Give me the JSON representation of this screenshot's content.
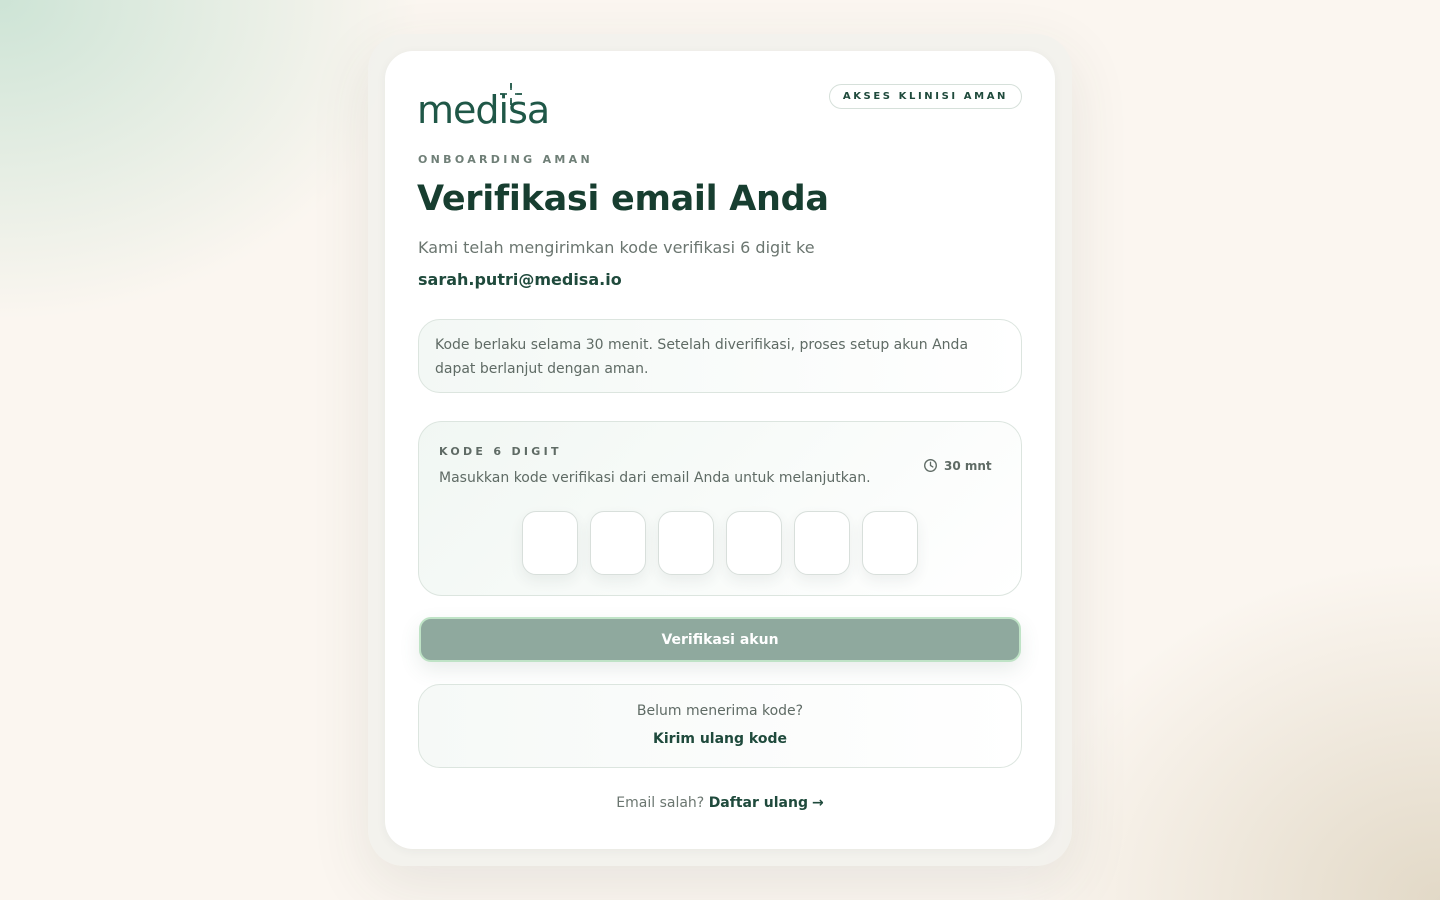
{
  "brand": {
    "name": "medisa",
    "primary_color": "#1f4a3c",
    "accent_color": "#8fa99e"
  },
  "badge": "AKSES KLINISI AMAN",
  "eyebrow": "ONBOARDING AMAN",
  "title": "Verifikasi email Anda",
  "subtitle": "Kami telah mengirimkan kode verifikasi 6 digit ke",
  "email": "sarah.putri@medisa.io",
  "info": "Kode berlaku selama 30 menit. Setelah diverifikasi, proses setup akun Anda dapat berlanjut dengan aman.",
  "code_panel": {
    "label": "KODE 6 DIGIT",
    "description": "Masukkan kode verifikasi dari email Anda untuk melanjutkan.",
    "timer": "30 mnt",
    "timer_icon": "clock-icon",
    "digits": [
      "",
      "",
      "",
      "",
      "",
      ""
    ]
  },
  "primary_button": "Verifikasi akun",
  "resend": {
    "question": "Belum menerima kode?",
    "link": "Kirim ulang kode"
  },
  "footer": {
    "text": "Email salah?",
    "link": "Daftar ulang",
    "arrow": "→"
  }
}
